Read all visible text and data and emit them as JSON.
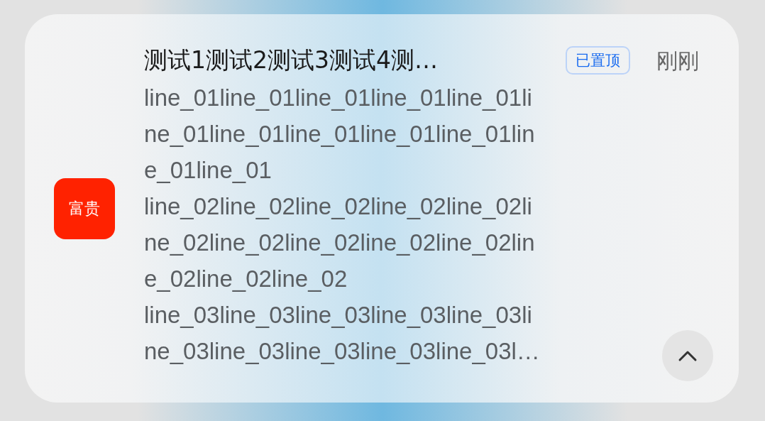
{
  "notification": {
    "app_icon_label": "富贵",
    "title": "测试1测试2测试3测试4测…",
    "badge": "已置顶",
    "time": "刚刚",
    "body_lines": [
      "line_01line_01line_01line_01line_01li",
      "ne_01line_01line_01line_01line_01lin",
      "e_01line_01",
      "line_02line_02line_02line_02line_02li",
      "ne_02line_02line_02line_02line_02lin",
      "e_02line_02line_02",
      "line_03line_03line_03line_03line_03li",
      "ne_03line_03line_03line_03line_03l…"
    ],
    "expanded": true
  }
}
